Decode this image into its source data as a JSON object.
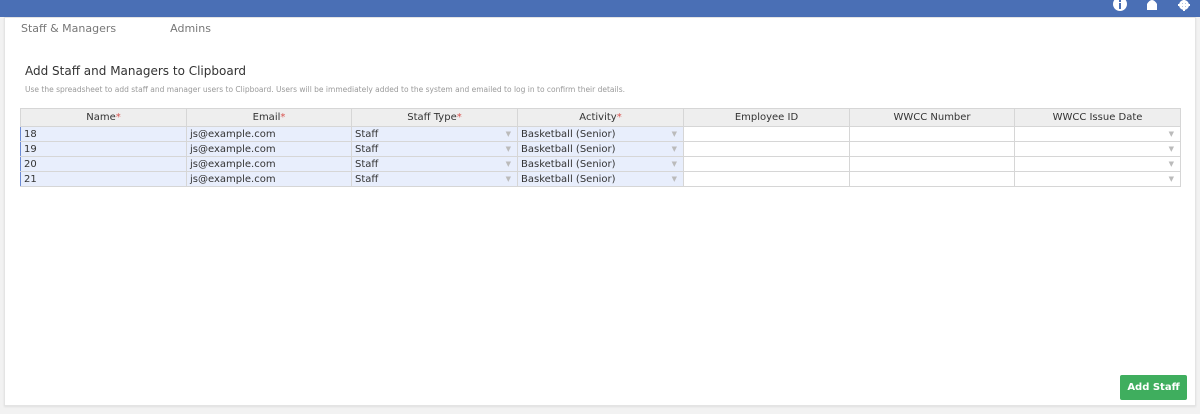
{
  "tabs": [
    "Staff & Managers",
    "Admins"
  ],
  "page": {
    "title": "Add Staff and Managers to Clipboard",
    "description": "Use the spreadsheet to add staff and manager users to Clipboard. Users will be immediately added to the system and emailed to log in to confirm their details."
  },
  "table": {
    "columns": [
      "Name",
      "Email",
      "Staff Type",
      "Activity",
      "Employee ID",
      "WWCC Number",
      "WWCC Issue Date"
    ],
    "rows": [
      [
        "18",
        "js@example.com",
        "Staff",
        "Basketball (Senior)",
        "",
        "",
        ""
      ],
      [
        "19",
        "js@example.com",
        "Staff",
        "Basketball (Senior)",
        "",
        "",
        ""
      ],
      [
        "20",
        "js@example.com",
        "Staff",
        "Basketball (Senior)",
        "",
        "",
        ""
      ],
      [
        "21",
        "js@example.com",
        "Staff",
        "Basketball (Senior)",
        "",
        "",
        ""
      ]
    ]
  },
  "actions": {
    "add_staff": "Add Staff"
  },
  "icons": [
    "info-icon",
    "bell-icon",
    "gear-icon"
  ],
  "colors": {
    "topbar": "#4a6fb5",
    "button": "#3fae5e",
    "selection": "#e8eefc",
    "required": "#d9534f"
  }
}
